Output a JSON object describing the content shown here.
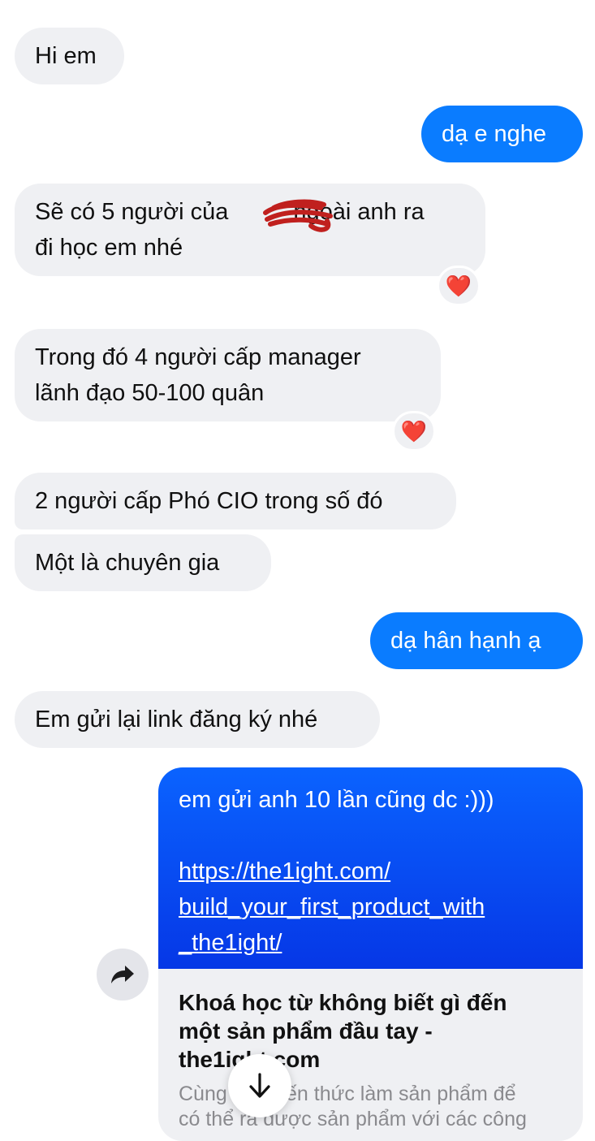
{
  "messages": [
    {
      "text": "Hi em"
    },
    {
      "text": "dạ e nghe"
    },
    {
      "line1_prefix": "Sẽ có 5 người của ",
      "line1_suffix": "ngoài anh ra",
      "line2": "đi học em nhé",
      "reaction": "❤️"
    },
    {
      "line1": "Trong đó 4 người cấp manager",
      "line2": "lãnh đạo 50-100 quân",
      "reaction": "❤️"
    },
    {
      "text": "2 người cấp Phó CIO trong số đó"
    },
    {
      "text": "Một là chuyên gia"
    },
    {
      "text": "dạ hân hạnh ạ"
    },
    {
      "text": "Em gửi lại link đăng ký nhé"
    }
  ],
  "link_message": {
    "text": "em gửi anh 10 lần cũng dc :)))",
    "url_line1": "https://the1ight.com/",
    "url_line2": "build_your_first_product_with",
    "url_line3": "_the1ight/",
    "preview_title_line1": "Khoá học từ không biết gì đến",
    "preview_title_line2": "một sản phẩm đầu tay -",
    "preview_title_line3": "the1ight.com",
    "preview_desc_line1": "Cùng học kiến thức làm sản phẩm để",
    "preview_desc_line2": "có thể ra được sản phẩm với các công"
  },
  "colors": {
    "incoming_bubble": "#eff0f3",
    "outgoing_bubble": "#0a7cff",
    "heart": "#e0142a",
    "redaction": "#c0201e"
  },
  "icons": {
    "share": "share-forward-icon",
    "scroll": "arrow-down-icon",
    "reaction": "heart-icon"
  }
}
